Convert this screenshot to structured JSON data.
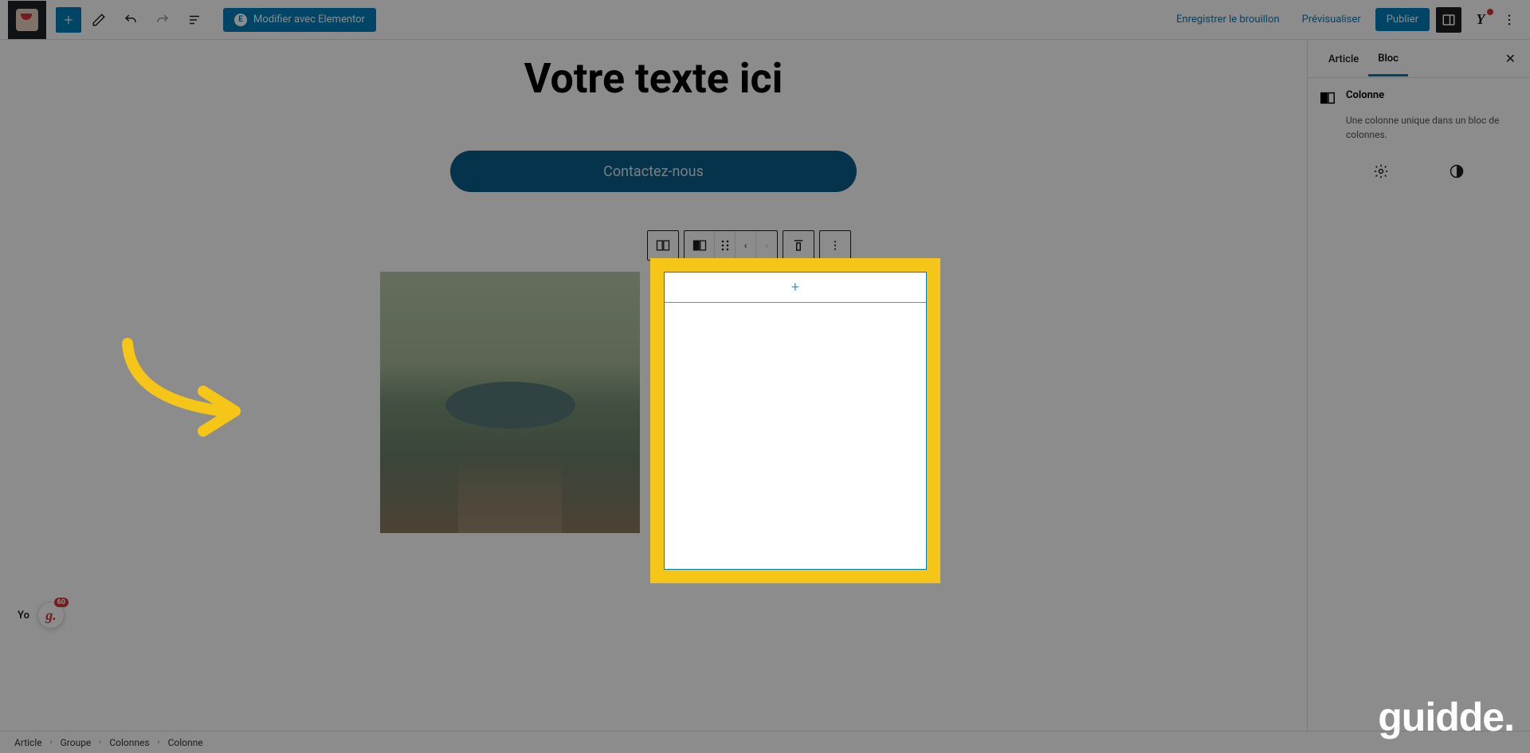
{
  "toolbar": {
    "elementor_label": "Modifier avec Elementor",
    "save_draft": "Enregistrer le brouillon",
    "preview": "Prévisualiser",
    "publish": "Publier"
  },
  "content": {
    "heading": "Votre texte ici",
    "cta": "Contactez-nous",
    "add_plus": "+"
  },
  "sidebar": {
    "tab_article": "Article",
    "tab_bloc": "Bloc",
    "block_name": "Colonne",
    "block_desc": "Une colonne unique dans un bloc de colonnes."
  },
  "breadcrumbs": [
    "Article",
    "Groupe",
    "Colonnes",
    "Colonne"
  ],
  "seo": {
    "prefix": "Yo",
    "badge_count": "60"
  },
  "watermark": "guidde."
}
